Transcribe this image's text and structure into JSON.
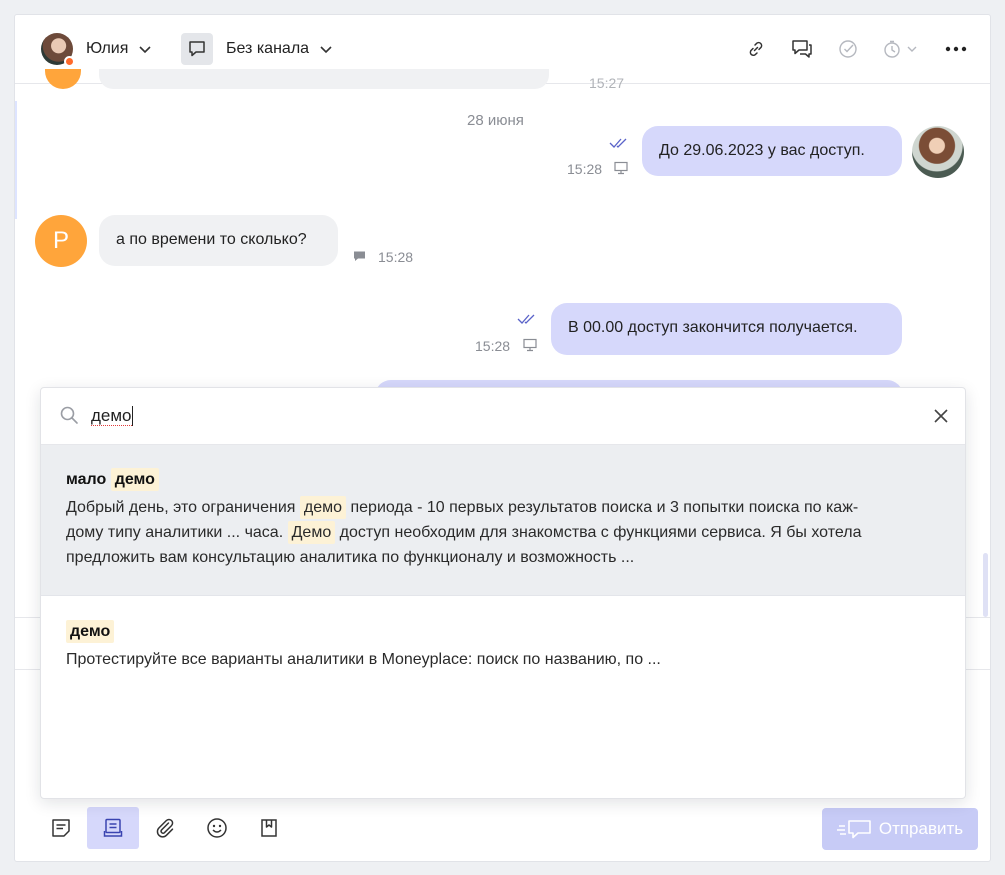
{
  "header": {
    "user_name": "Юлия",
    "channel_name": "Без канала",
    "actions": [
      "link-icon",
      "chat-bubbles-icon",
      "check-circle-icon",
      "timer-icon",
      "more-icon"
    ]
  },
  "chat": {
    "date_separator": "28 июня",
    "partial_top_time": "15:27",
    "messages": [
      {
        "direction": "out",
        "text": "До 29.06.2023 у вас доступ.",
        "time": "15:28",
        "read": true
      },
      {
        "direction": "in",
        "author_initial": "Р",
        "text": "а по времени то сколько?",
        "time": "15:28"
      },
      {
        "direction": "out",
        "text": "В 00.00 доступ закончится получается.",
        "time": "15:28",
        "read": true
      }
    ]
  },
  "search": {
    "query": "демо",
    "placeholder": "",
    "results": [
      {
        "title_prefix": "мало ",
        "title_highlight": "демо",
        "text_parts": [
          {
            "t": "Добрый день, это ограничения "
          },
          {
            "t": "демо",
            "hl": true
          },
          {
            "t": " периода - 10 первых результатов поиска и 3 попытки поиска по каж-"
          },
          {
            "br": true
          },
          {
            "t": "дому типу аналитики ... часа. "
          },
          {
            "t": "Демо",
            "hl": true
          },
          {
            "t": " доступ необходим для знакомства с функциями сервиса. Я бы хотела"
          },
          {
            "br": true
          },
          {
            "t": "предложить вам консультацию аналитика по функционалу и возможность ..."
          }
        ]
      },
      {
        "title_prefix": "",
        "title_highlight": "демо",
        "text": "Протестируйте все варианты аналитики в Moneyplace: поиск по названию, по ..."
      }
    ]
  },
  "composer": {
    "tools": [
      "template-icon",
      "knowledge-base-icon",
      "attach-icon",
      "emoji-icon",
      "bookmark-icon"
    ],
    "send_label": "Отправить"
  },
  "colors": {
    "accent": "#d6d8fb",
    "send_disabled": "#c7cbf6",
    "highlight": "#fdf2d6",
    "avatar_orange": "#ffa53b",
    "status_orange": "#ff6a2b"
  }
}
